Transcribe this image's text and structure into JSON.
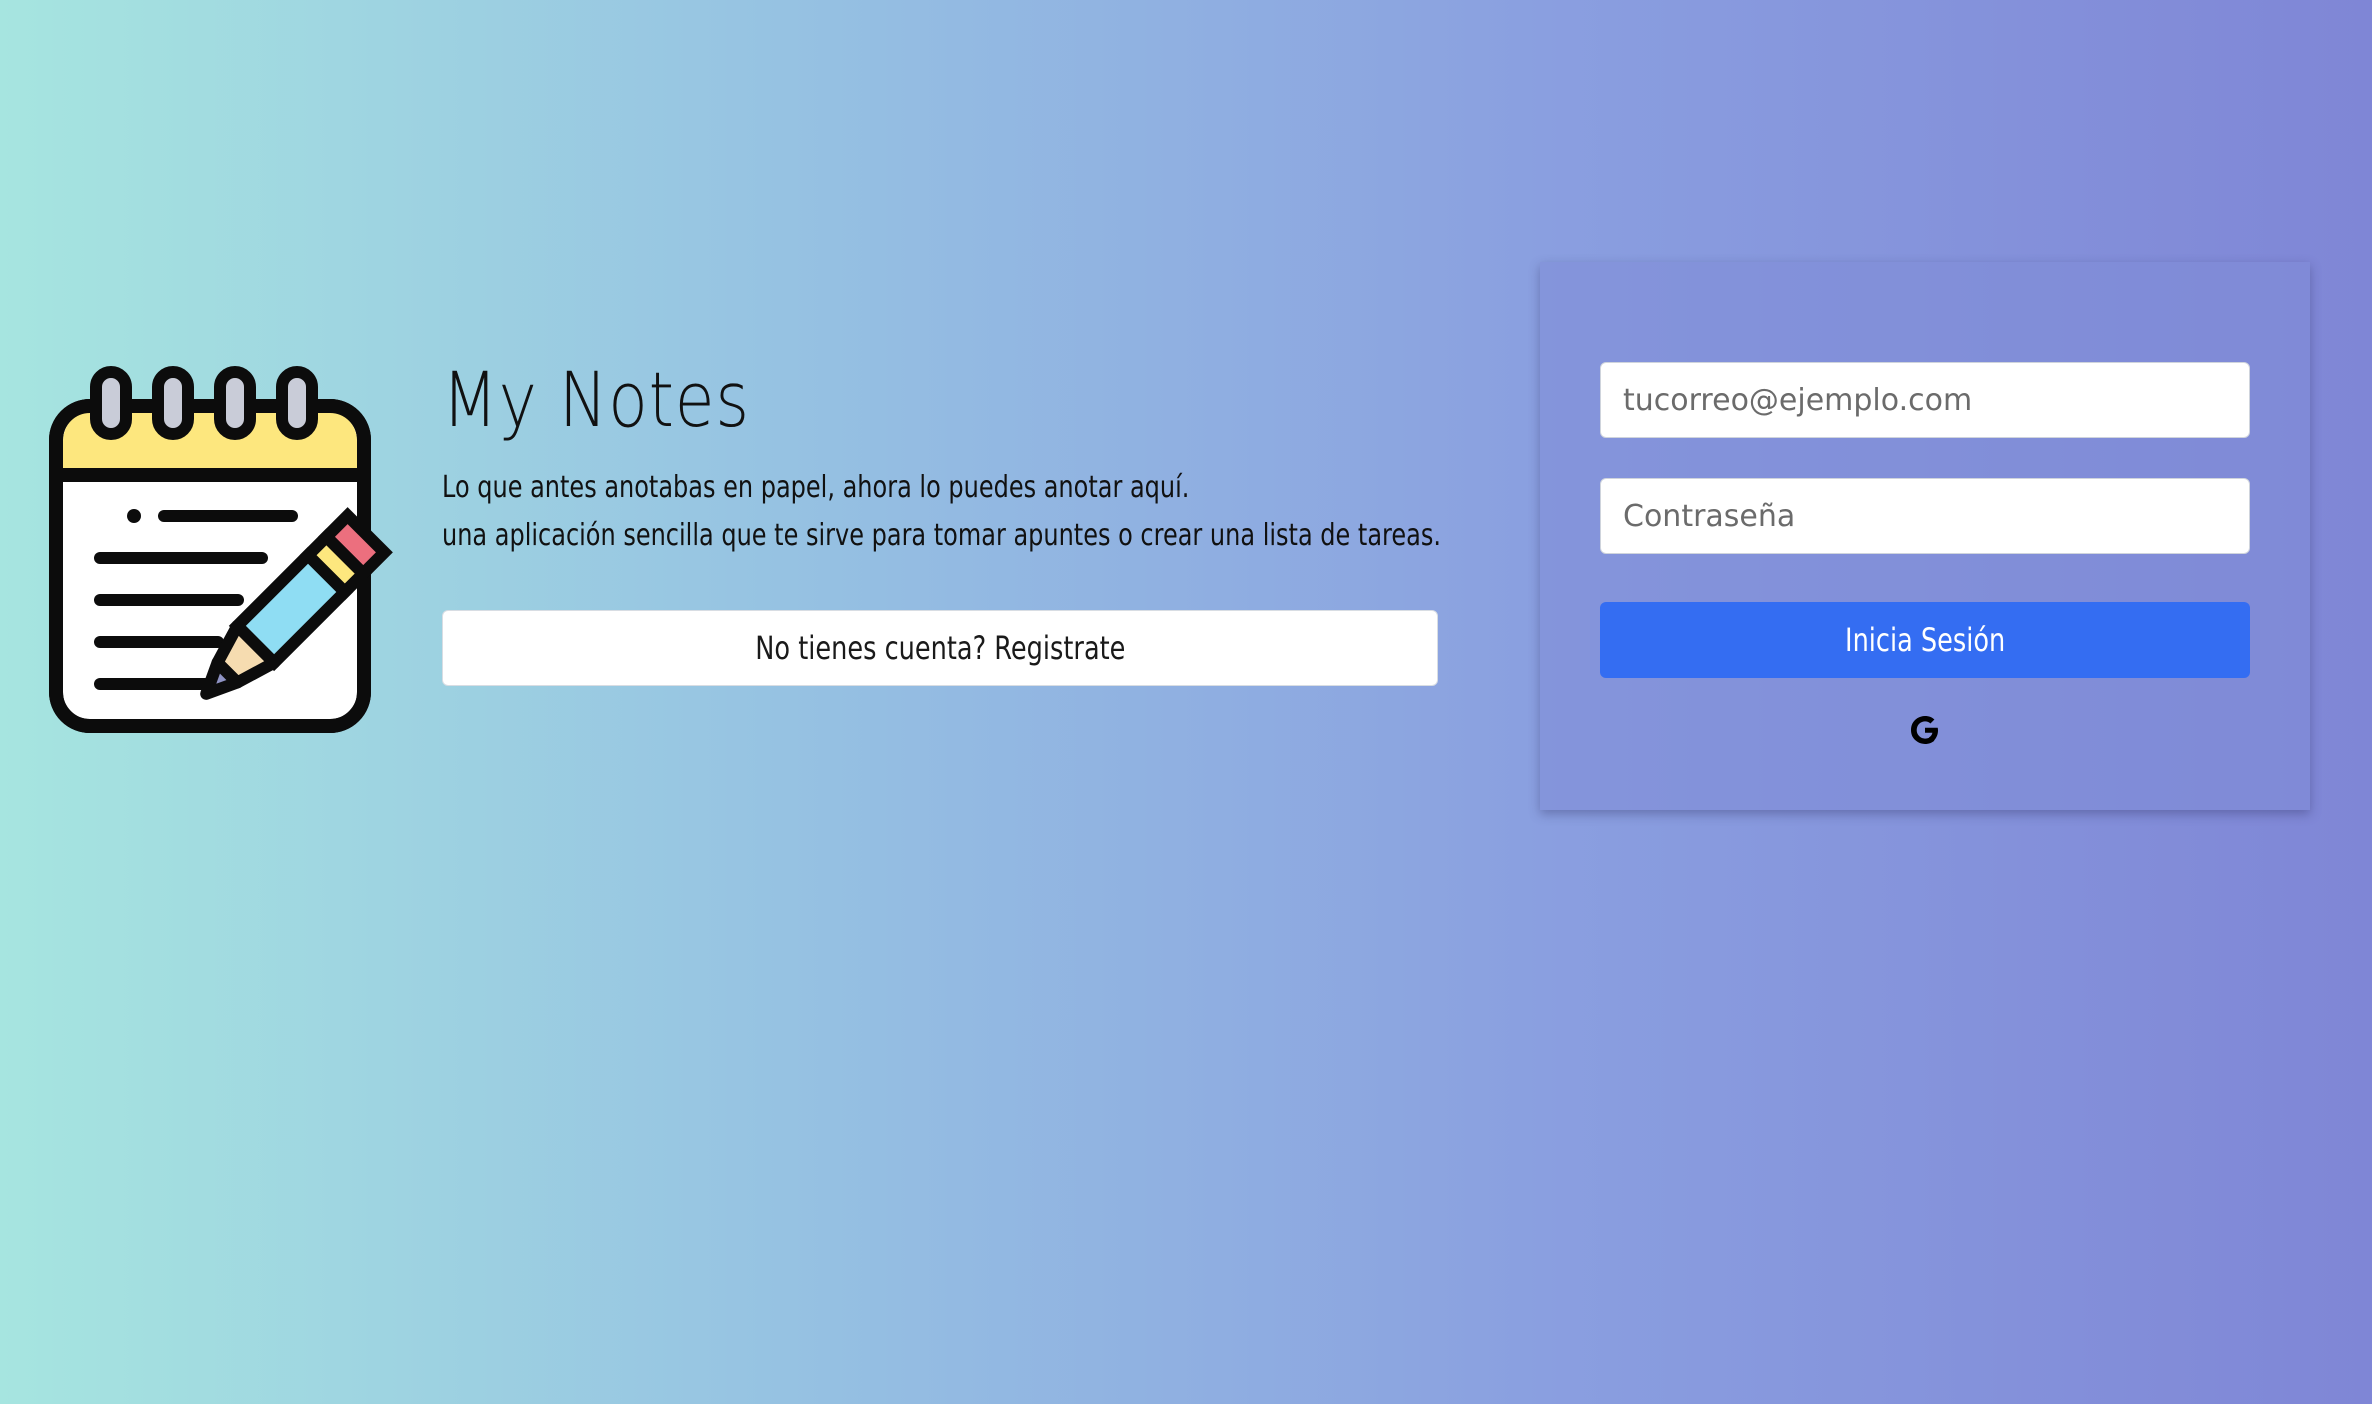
{
  "app": {
    "title": "My Notes",
    "tagline_line1": "Lo que antes anotabas en papel, ahora lo puedes anotar aquí.",
    "tagline_line2": "una aplicación sencilla que te sirve para tomar apuntes o crear una lista de tareas."
  },
  "register": {
    "label": "No tienes cuenta? Registrate"
  },
  "login": {
    "email_placeholder": "tucorreo@ejemplo.com",
    "email_value": "",
    "password_placeholder": "Contraseña",
    "password_value": "",
    "submit_label": "Inicia Sesión",
    "google_icon": "google-icon"
  },
  "colors": {
    "primary_button": "#346df2",
    "background_start": "#a6e5e0",
    "background_end": "#7f86d6"
  },
  "icons": {
    "logo": "notepad-pencil-icon"
  }
}
